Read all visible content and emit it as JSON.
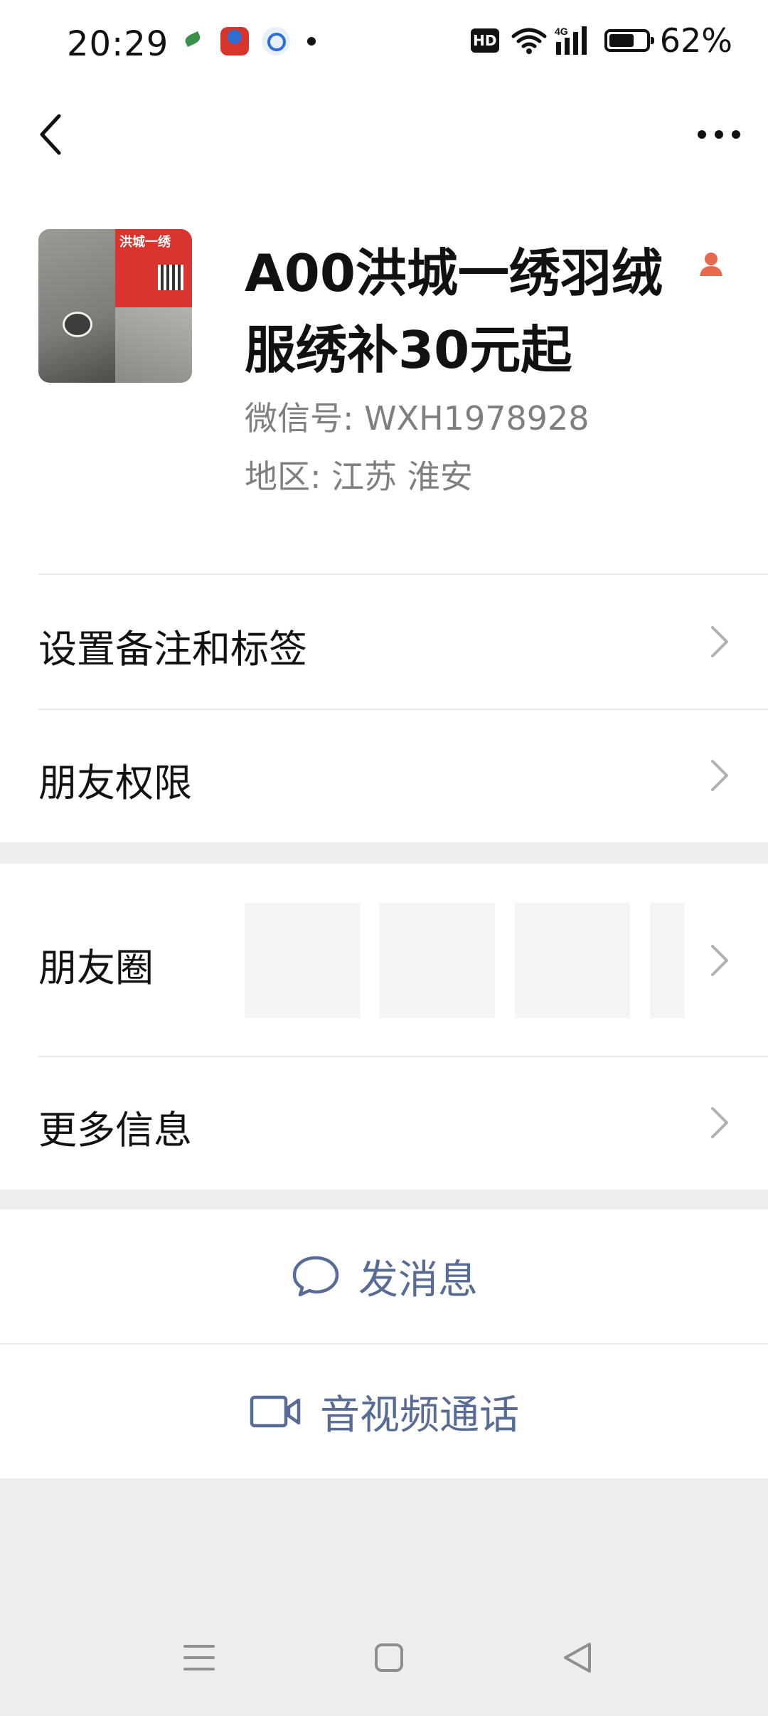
{
  "status_bar": {
    "time": "20:29",
    "hd": "HD",
    "network": "4G",
    "battery": "62%",
    "battery_level_percent": 62,
    "app_icons": [
      "leaf-app-icon",
      "red-app-icon",
      "blue-app-icon"
    ]
  },
  "nav": {
    "back_icon": "chevron-left-icon",
    "more_icon": "more-dots-icon"
  },
  "profile": {
    "name": "A00洪城一绣羽绒服绣补30元起",
    "wechat_id": "微信号:  WXH1978928",
    "region": "地区:  江苏  淮安",
    "avatar_text": "洪城一绣",
    "gender_icon": "female-user-icon",
    "gender_color": "#e9694f"
  },
  "menu": {
    "remark": "设置备注和标签",
    "permission": "朋友权限",
    "moments": "朋友圈",
    "more_info": "更多信息"
  },
  "actions": {
    "message": "发消息",
    "call": "音视频通话",
    "accent_color": "#576b95"
  },
  "system_nav": {
    "icons": [
      "menu-icon",
      "home-icon",
      "back-triangle-icon"
    ]
  }
}
